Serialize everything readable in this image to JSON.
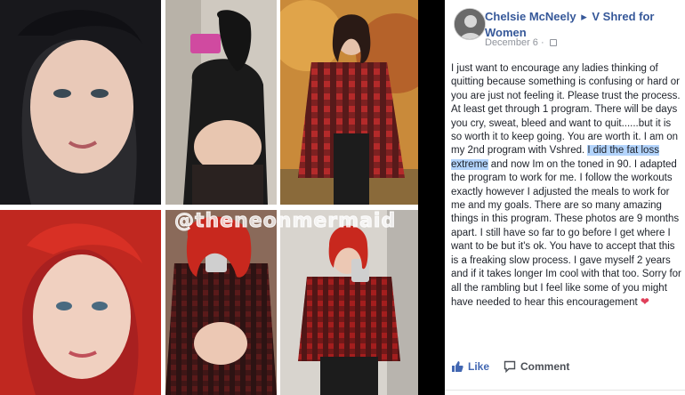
{
  "collage": {
    "watermark": "@theneonmermaid"
  },
  "post": {
    "author": "Chelsie McNeely",
    "arrow": "▸",
    "group": "V Shred for Women",
    "date": "December 6",
    "separator": "·",
    "body_part1": "I just want to encourage any ladies thinking of quitting because something is confusing or hard or you are just not feeling it. Please trust the process. At least get through 1 program. There will be days you cry, sweat, bleed and want to quit......but it is so worth it to keep going. You are worth it. I am on my 2nd program with Vshred. ",
    "body_highlight": "I did the fat loss extreme",
    "body_part2": " and now Im on the toned in 90. I adapted the program to work for me. I follow the workouts exactly however I adjusted the meals to work for me and my goals. There are so many amazing things in this program. These photos are 9 months apart. I still have so far to go before I get where I want to be but it's ok. You have to accept that this is a freaking slow process. I gave myself 2 years and if it takes longer Im cool with that too. Sorry for all the rambling but I feel like some of you might have needed to hear this encouragement ",
    "heart": "❤",
    "like_label": "Like",
    "comment_label": "Comment"
  },
  "colors": {
    "link": "#365899",
    "like": "#4267b2",
    "highlight": "#b3d4fc",
    "heart": "#e0405a"
  }
}
